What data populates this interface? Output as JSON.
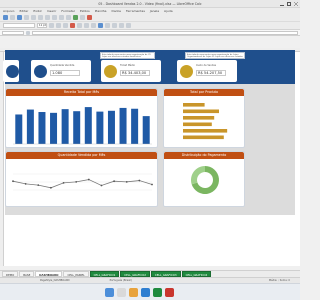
{
  "window": {
    "title": "05 - Dashboard Vendas 2.0 - Vídeo (final).xlsx — LibreOffice Calc"
  },
  "menu": [
    "Arquivo",
    "Editar",
    "Exibir",
    "Inserir",
    "Formatar",
    "Estilos",
    "Planilha",
    "Dados",
    "Ferramentas",
    "Janela",
    "Ajuda"
  ],
  "toolbar": {
    "font_size": "11 pt"
  },
  "notes": {
    "left": "Esta tabela representa uma organização de 31 Lojas em diversos estados brasileiros",
    "right": "Esta tabela representa uma organização de Lojas. Organizadores de Lojas 31 Lojas em diversos estados brasileiros"
  },
  "kpis": [
    {
      "label": "Quantidade Vendida",
      "value": "1.080",
      "icon": "cart-icon",
      "color": "#1f4f8c"
    },
    {
      "label": "Ticket Médio",
      "value": "R$ 34.403,00",
      "icon": "coin-icon",
      "color": "#c9a227"
    },
    {
      "label": "Custo de Vendas",
      "value": "R$ 54.207,50",
      "icon": "coin-stack-icon",
      "color": "#c9a227"
    }
  ],
  "panels": {
    "revenue": "Receita Total por Mês",
    "product": "Total por Produto",
    "quantity": "Quantidade Vendida por Mês",
    "payment": "Distribuição do Pagamento"
  },
  "chart_data": [
    {
      "type": "bar",
      "title": "Receita Total por Mês",
      "values": [
        72,
        84,
        78,
        76,
        85,
        80,
        90,
        79,
        81,
        88,
        86,
        68
      ]
    },
    {
      "type": "bar",
      "title": "Total por Produto",
      "orientation": "horizontal",
      "values": [
        45,
        75,
        65,
        60,
        92,
        85
      ]
    },
    {
      "type": "line",
      "title": "Quantidade Vendida por Mês",
      "values": [
        60,
        52,
        48,
        40,
        55,
        58,
        65,
        47,
        60,
        58,
        62,
        50
      ]
    },
    {
      "type": "pie",
      "title": "Distribuição do Pagamento",
      "values": [
        70,
        30
      ],
      "colors": [
        "#7bb661",
        "#9fd08a"
      ]
    }
  ],
  "sheet_tabs": [
    "DEMO",
    "BASE",
    "DASHBOARD",
    "CELL_PAINEL",
    "CELL_GRAFICO1",
    "CELL_GRAFICO2",
    "CELL_GRAFICO3",
    "CELL_GRAFICO4"
  ],
  "active_tab": "DASHBOARD",
  "status": {
    "left": "PageStyle_DASHBOARD",
    "mid": "Português (Brasil)",
    "right": "Média: ; Soma: 0"
  }
}
